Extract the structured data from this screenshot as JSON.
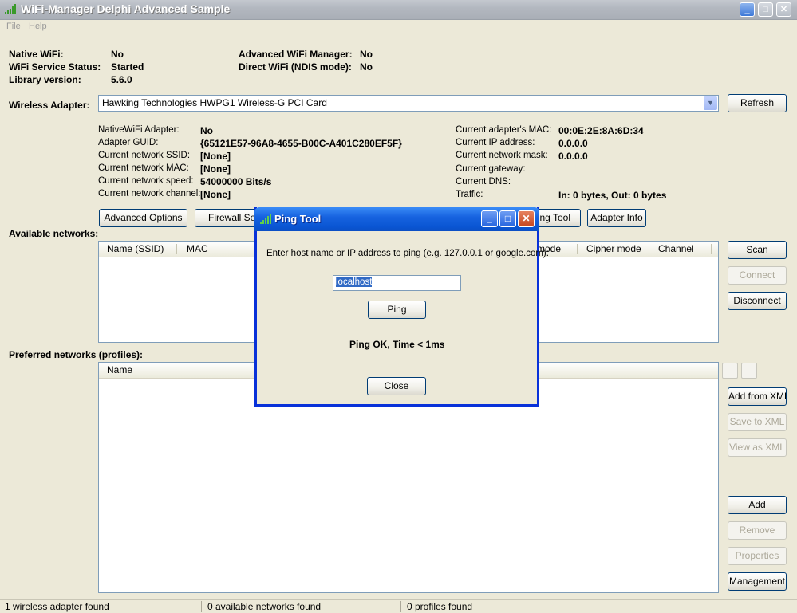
{
  "window": {
    "title": "WiFi-Manager Delphi Advanced Sample",
    "controls": {
      "minimize": "_",
      "maximize": "□",
      "close": "✕"
    }
  },
  "menu": {
    "file": "File",
    "help": "Help"
  },
  "summary": {
    "native_wifi_label": "Native WiFi:",
    "native_wifi_value": "No",
    "service_status_label": "WiFi Service Status:",
    "service_status_value": "Started",
    "library_version_label": "Library version:",
    "library_version_value": "5.6.0",
    "advanced_manager_label": "Advanced WiFi Manager:",
    "advanced_manager_value": "No",
    "direct_wifi_label": "Direct WiFi (NDIS mode):",
    "direct_wifi_value": "No"
  },
  "adapter": {
    "label": "Wireless Adapter:",
    "selected": "Hawking Technologies HWPG1 Wireless-G PCI Card",
    "refresh": "Refresh"
  },
  "details_left": [
    {
      "label": "NativeWiFi Adapter:",
      "value": "No"
    },
    {
      "label": "Adapter GUID:",
      "value": "{65121E57-96A8-4655-B00C-A401C280EF5F}"
    },
    {
      "label": "Current network SSID:",
      "value": "[None]"
    },
    {
      "label": "Current network MAC:",
      "value": "[None]"
    },
    {
      "label": "Current network speed:",
      "value": "54000000 Bits/s"
    },
    {
      "label": "Current network channel:",
      "value": "[None]"
    }
  ],
  "details_right": [
    {
      "label": "Current adapter's MAC:",
      "value": "00:0E:2E:8A:6D:34"
    },
    {
      "label": "Current IP address:",
      "value": "0.0.0.0"
    },
    {
      "label": "Current network mask:",
      "value": "0.0.0.0"
    },
    {
      "label": "Current gateway:",
      "value": ""
    },
    {
      "label": "Current DNS:",
      "value": ""
    },
    {
      "label": "Traffic:",
      "value": "In: 0 bytes, Out: 0 bytes"
    }
  ],
  "tool_buttons": {
    "advanced_options": "Advanced Options",
    "firewall_settings": "Firewall Setti",
    "ping_tool": "ing Tool",
    "adapter_info": "Adapter Info"
  },
  "available": {
    "label": "Available networks:",
    "columns": [
      "Name (SSID)",
      "MAC",
      "mode",
      "Cipher mode",
      "Channel"
    ],
    "scan": "Scan",
    "connect": "Connect",
    "disconnect": "Disconnect"
  },
  "preferred": {
    "label": "Preferred networks (profiles):",
    "columns": [
      "Name"
    ],
    "add_from_xml": "Add from XML",
    "save_to_xml": "Save to XML",
    "view_as_xml": "View as XML",
    "add": "Add",
    "remove": "Remove",
    "properties": "Properties",
    "management": "Management"
  },
  "status": {
    "adapters": "1 wireless adapter found",
    "networks": "0 available networks found",
    "profiles": "0 profiles found"
  },
  "ping_dialog": {
    "title": "Ping Tool",
    "prompt": "Enter host name or IP address to ping (e.g. 127.0.0.1 or google.com):",
    "host_value": "localhost",
    "ping": "Ping",
    "result": "Ping OK, Time < 1ms",
    "close": "Close"
  },
  "colors": {
    "xp_blue": "#0831d9",
    "face": "#ece9d8",
    "border": "#7f9db9"
  }
}
